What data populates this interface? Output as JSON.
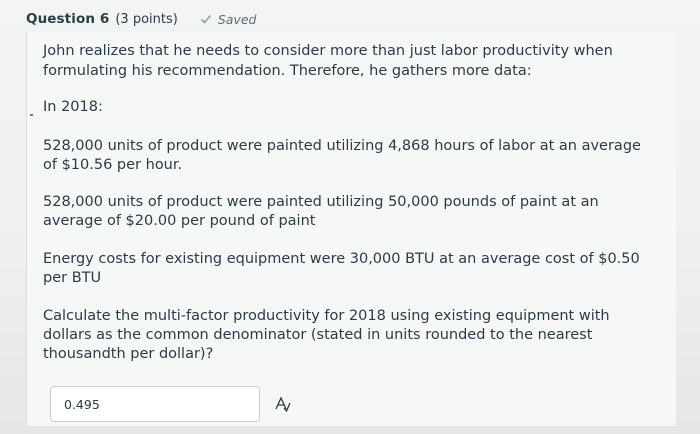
{
  "question": {
    "title": "Question 6",
    "points": "(3 points)",
    "status": "Saved",
    "intro_line1": "John realizes that he needs to consider more than just labor productivity when",
    "intro_line2": "formulating his recommendation. Therefore, he gathers more data:",
    "year_heading": "In 2018:",
    "labor_line1": "528,000 units of product were painted utilizing  4,868 hours of labor at an average",
    "labor_line2": "of $10.56 per hour.",
    "paint_line1": "528,000 units of product were painted utilizing  50,000 pounds of paint at an",
    "paint_line2": "average of $20.00 per pound of paint",
    "energy_line1": "Energy costs for existing equipment were 30,000 BTU at an average cost of $0.50",
    "energy_line2": "per BTU",
    "prompt_line1": "Calculate the multi-factor productivity for 2018 using existing equipment with",
    "prompt_line2": "dollars as the common denominator (stated in units rounded to the nearest",
    "prompt_line3": "thousandth per dollar)?"
  },
  "answer": {
    "value": "0.495"
  },
  "icons": {
    "saved": "checkmark-icon",
    "equation": "equation-editor-icon"
  },
  "colors": {
    "text": "#2d3b45",
    "check": "#8aa0ad"
  }
}
